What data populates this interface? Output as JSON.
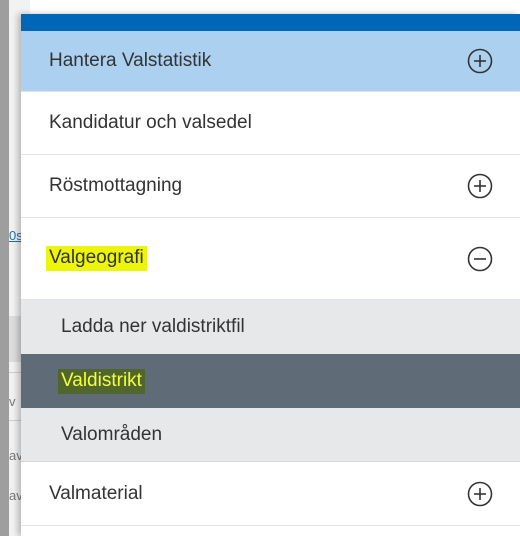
{
  "background": {
    "fragments": [
      "0s",
      "v",
      "av",
      "av"
    ]
  },
  "menu": {
    "items": [
      {
        "label": "Hantera Valstatistik",
        "icon": "plus-circle-icon"
      },
      {
        "label": "Kandidatur och valsedel"
      },
      {
        "label": "Röstmottagning",
        "icon": "plus-circle-icon"
      },
      {
        "label": "Valgeografi",
        "icon": "minus-circle-icon",
        "children": [
          {
            "label": "Ladda ner valdistriktfil"
          },
          {
            "label": "Valdistrikt"
          },
          {
            "label": "Valområden"
          }
        ]
      },
      {
        "label": "Valmaterial",
        "icon": "plus-circle-icon"
      }
    ]
  },
  "colors": {
    "topbar": "#0067b8",
    "active_item": "#acd1f0",
    "submenu_bg": "#e7e8ea",
    "selected_subitem": "#5f6c77",
    "highlight": "#ecf50a"
  }
}
